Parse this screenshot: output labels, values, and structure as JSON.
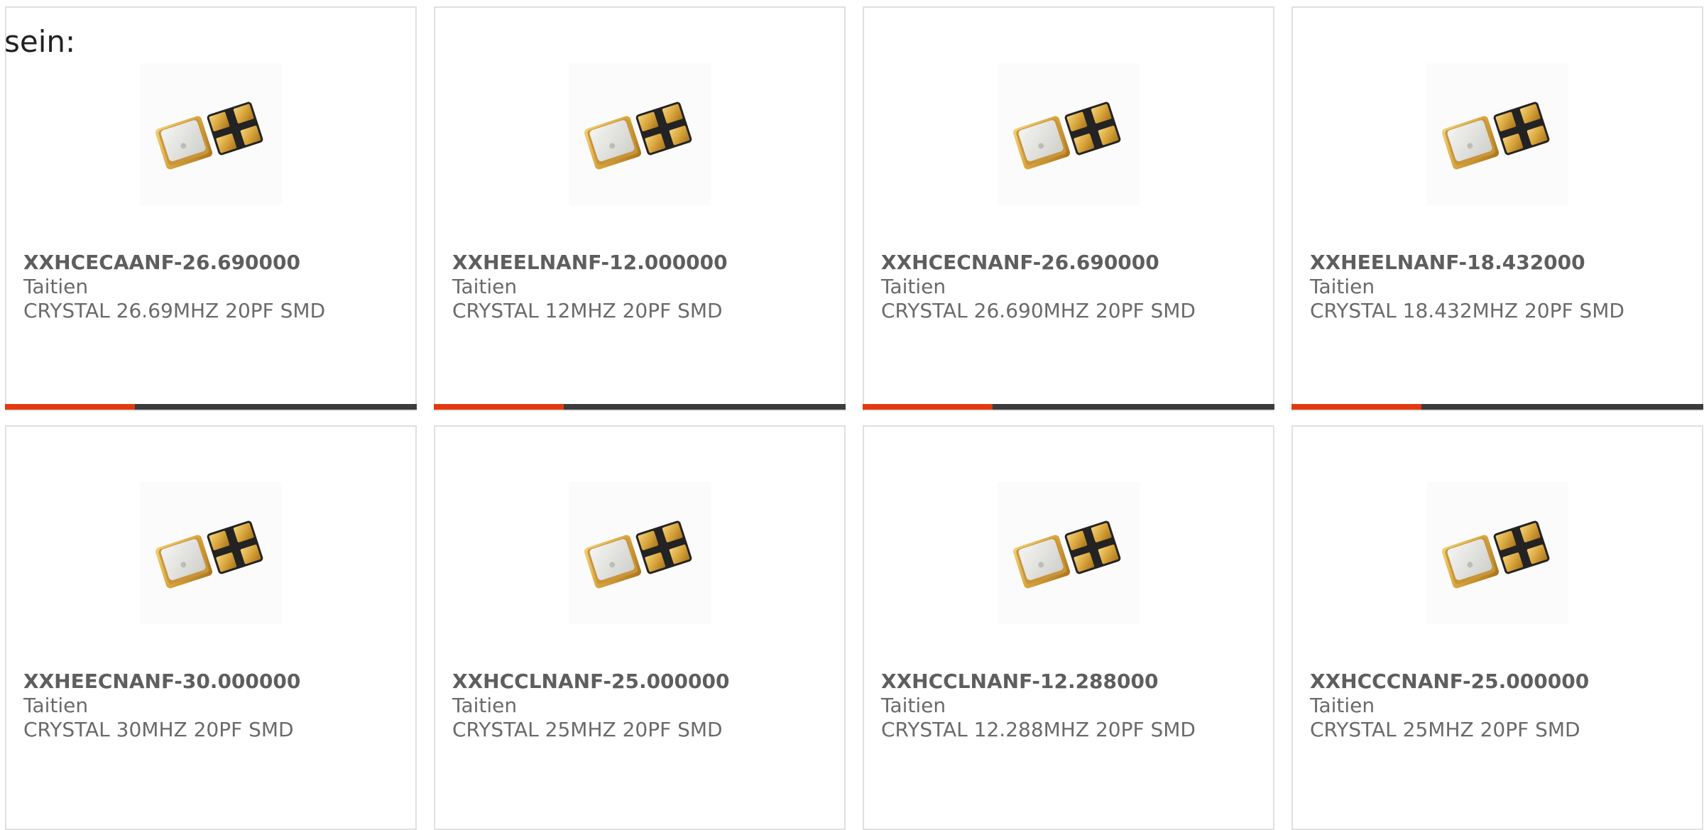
{
  "intro_text": "sein:",
  "colors": {
    "accent": "#e13a11",
    "bar": "#3c3c3c",
    "border": "#e0e0e0",
    "text": "#666666"
  },
  "accent_fraction": 0.315,
  "products": [
    {
      "part": "XXHCECAANF-26.690000",
      "manufacturer": "Taitien",
      "description": "CRYSTAL 26.69MHZ 20PF SMD",
      "image_icon": "crystal-oscillator-icon"
    },
    {
      "part": "XXHEELNANF-12.000000",
      "manufacturer": "Taitien",
      "description": "CRYSTAL 12MHZ 20PF SMD",
      "image_icon": "crystal-oscillator-icon"
    },
    {
      "part": "XXHCECNANF-26.690000",
      "manufacturer": "Taitien",
      "description": "CRYSTAL 26.690MHZ 20PF SMD",
      "image_icon": "crystal-oscillator-icon"
    },
    {
      "part": "XXHEELNANF-18.432000",
      "manufacturer": "Taitien",
      "description": "CRYSTAL 18.432MHZ 20PF SMD",
      "image_icon": "crystal-oscillator-icon"
    },
    {
      "part": "XXHEECNANF-30.000000",
      "manufacturer": "Taitien",
      "description": "CRYSTAL 30MHZ 20PF SMD",
      "image_icon": "crystal-oscillator-icon"
    },
    {
      "part": "XXHCCLNANF-25.000000",
      "manufacturer": "Taitien",
      "description": "CRYSTAL 25MHZ 20PF SMD",
      "image_icon": "crystal-oscillator-icon"
    },
    {
      "part": "XXHCCLNANF-12.288000",
      "manufacturer": "Taitien",
      "description": "CRYSTAL 12.288MHZ 20PF SMD",
      "image_icon": "crystal-oscillator-icon"
    },
    {
      "part": "XXHCCCNANF-25.000000",
      "manufacturer": "Taitien",
      "description": "CRYSTAL 25MHZ 20PF SMD",
      "image_icon": "crystal-oscillator-icon"
    }
  ]
}
